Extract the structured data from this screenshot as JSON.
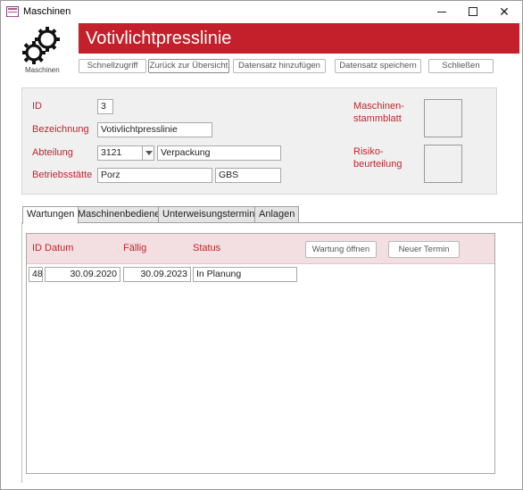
{
  "window": {
    "title": "Maschinen"
  },
  "header": {
    "logo_label": "Maschinen",
    "title": "Votivlichtpresslinie"
  },
  "toolbar": {
    "quick_access": "Schnellzugriff",
    "back_overview": "Zurück zur Übersicht",
    "add_record": "Datensatz hinzufügen",
    "save_record": "Datensatz speichern",
    "close": "Schließen"
  },
  "detail": {
    "id_label": "ID",
    "id_value": "3",
    "name_label": "Bezeichnung",
    "name_value": "Votivlichtpresslinie",
    "dept_label": "Abteilung",
    "dept_code": "3121",
    "dept_name": "Verpackung",
    "site_label": "Betriebsstätte",
    "site_name": "Porz",
    "site_code": "GBS",
    "sheet_label_1": "Maschinen-",
    "sheet_label_2": "stammblatt",
    "risk_label_1": "Risiko-",
    "risk_label_2": "beurteilung"
  },
  "tabs": [
    {
      "label": "Wartungen",
      "active": true
    },
    {
      "label": "Maschinenbediener",
      "active": false
    },
    {
      "label": "Unterweisungstermine",
      "active": false
    },
    {
      "label": "Anlagen",
      "active": false
    }
  ],
  "maintenance": {
    "columns": {
      "id": "ID",
      "date": "Datum",
      "due": "Fällig",
      "status": "Status"
    },
    "open_button": "Wartung öffnen",
    "new_button": "Neuer Termin",
    "rows": [
      {
        "id": "48",
        "date": "30.09.2020",
        "due": "30.09.2023",
        "status": "In Planung"
      }
    ]
  },
  "colors": {
    "accent": "#c3202b",
    "label": "#c0262e",
    "subform_header": "#f3dfe1",
    "panel": "#f0f0f0"
  }
}
